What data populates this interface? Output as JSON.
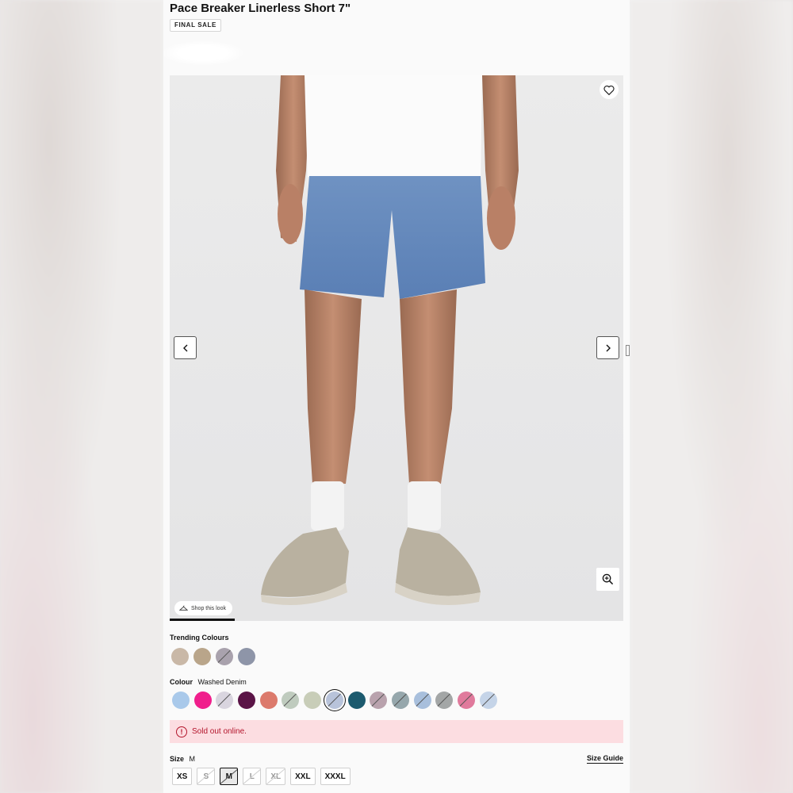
{
  "product": {
    "title": "Pace Breaker Linerless Short 7\"",
    "badge": "FINAL SALE"
  },
  "gallery": {
    "shop_this_look": "Shop this look",
    "icons": [
      "heart-icon",
      "chevron-left-icon",
      "chevron-right-icon",
      "zoom-in-icon",
      "hanger-icon"
    ]
  },
  "trending": {
    "label": "Trending Colours",
    "swatches": [
      {
        "color": "#c9b8a7",
        "available": true
      },
      {
        "color": "#b9a58a",
        "available": true
      },
      {
        "color": "#a9a2ad",
        "available": false
      },
      {
        "color": "#8e95a8",
        "available": true
      }
    ]
  },
  "colour": {
    "label": "Colour",
    "selected_name": "Washed Denim",
    "swatches": [
      {
        "color": "#a9c9ea",
        "available": true
      },
      {
        "color": "#f01f8c",
        "available": true
      },
      {
        "color": "#d9d5df",
        "available": false
      },
      {
        "color": "#5a1446",
        "available": true
      },
      {
        "color": "#dc7a6c",
        "available": true
      },
      {
        "color": "#bfcbbe",
        "available": false
      },
      {
        "color": "#c8cdb8",
        "available": true
      },
      {
        "color": "#b8c3da",
        "available": false,
        "selected": true
      },
      {
        "color": "#1c5a6e",
        "available": true
      },
      {
        "color": "#b9a2ad",
        "available": false
      },
      {
        "color": "#96a7ac",
        "available": false
      },
      {
        "color": "#a8bfdc",
        "available": false
      },
      {
        "color": "#a3a6a6",
        "available": false
      },
      {
        "color": "#e07a9c",
        "available": false
      },
      {
        "color": "#c5d4e8",
        "available": false
      }
    ]
  },
  "alert": {
    "icon": "exclamation-circle-icon",
    "text": "Sold out online."
  },
  "size": {
    "label": "Size",
    "selected": "M",
    "guide_label": "Size Guide",
    "options": [
      {
        "label": "XS",
        "available": true
      },
      {
        "label": "S",
        "available": false
      },
      {
        "label": "M",
        "available": false,
        "selected": true
      },
      {
        "label": "L",
        "available": false
      },
      {
        "label": "XL",
        "available": false
      },
      {
        "label": "XXL",
        "available": true
      },
      {
        "label": "XXXL",
        "available": true
      }
    ]
  }
}
